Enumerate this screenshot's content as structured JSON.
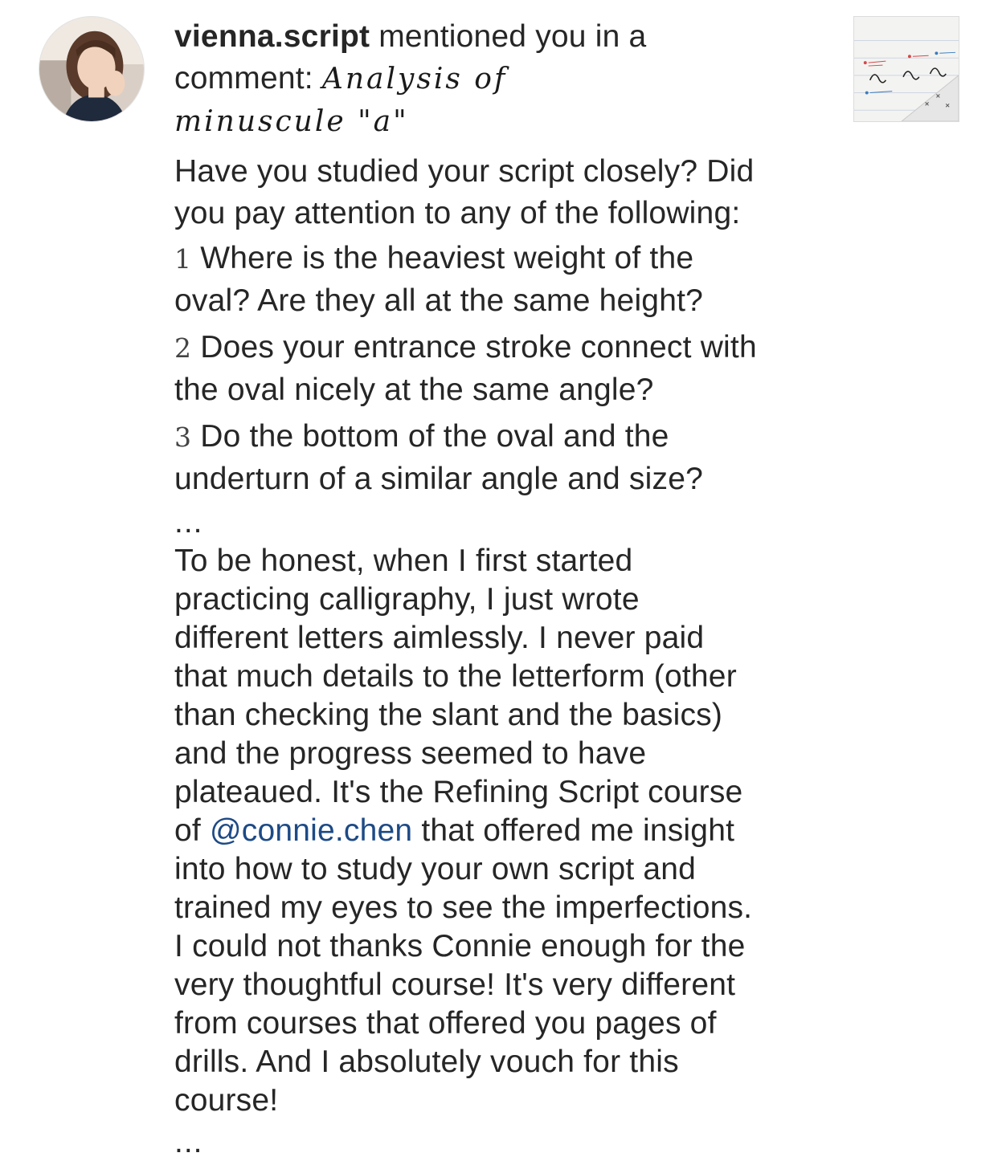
{
  "notification": {
    "username": "vienna.script",
    "action_line_1": " mentioned you in a",
    "action_line_2_prefix": "comment: ",
    "comment_title_part1": "Analysis of",
    "comment_title_part2": "minuscule \"a\"",
    "paragraph_1": [
      "Have you studied your script closely? Did",
      "you pay attention to any of the following:"
    ],
    "points": [
      {
        "num": "1",
        "line1": " Where is the heaviest weight of the",
        "line2": "oval? Are they all at the same height?"
      },
      {
        "num": "2",
        "line1": " Does your entrance stroke connect with",
        "line2": "the oval nicely at the same angle?"
      },
      {
        "num": "3",
        "line1": " Do the bottom of the oval and the",
        "line2": "underturn of a similar angle and size?"
      }
    ],
    "ellipsis_1": "...",
    "paragraph_2": [
      "To be honest, when I first started",
      "practicing calligraphy, I just wrote",
      "different letters aimlessly. I never paid",
      "that much details to the letterform (other",
      "than checking the slant and the basics)",
      "and the progress seemed to have",
      "plateaued. It's the Refining Script course"
    ],
    "mention_prefix": "of ",
    "mention_handle": "@connie.chen",
    "mention_suffix": " that offered me insight",
    "paragraph_3": [
      "into how to study your own script and",
      "trained my eyes to see the imperfections.",
      "I could not thanks Connie enough for the",
      "very thoughtful course! It's very different",
      "from courses that offered you pages of",
      "drills. And I absolutely vouch for this",
      "course!"
    ],
    "ellipsis_2": "..."
  },
  "colors": {
    "text": "#262626",
    "mention": "#1d4a86",
    "background": "#ffffff"
  },
  "icons": {
    "avatar": "user-avatar-photo",
    "thumbnail": "post-thumbnail-calligraphy"
  }
}
